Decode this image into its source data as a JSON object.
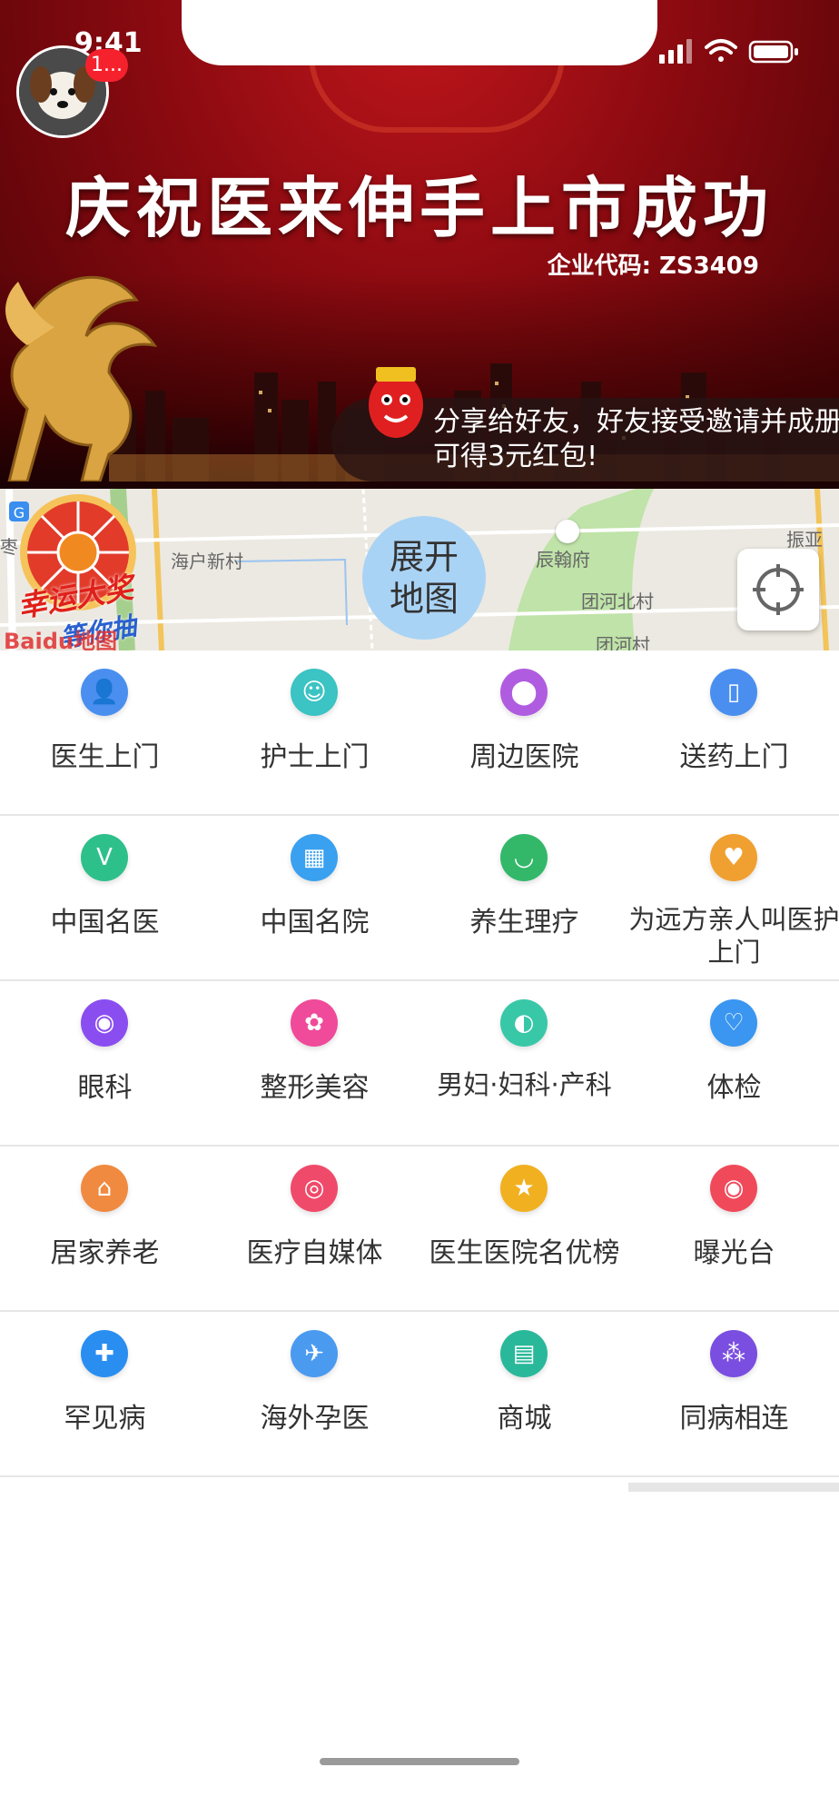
{
  "status_bar": {
    "time": "9:41"
  },
  "profile": {
    "badge": "1..."
  },
  "banner": {
    "title": "庆祝医来伸手上市成功",
    "company_code": "企业代码: ZS3409",
    "share_text": "分享给好友，好友接受邀请并成册可得3元红包!"
  },
  "map": {
    "expand_label_line1": "展开",
    "expand_label_line2": "地图",
    "labels": [
      "海户新村",
      "辰翰府",
      "团河北村",
      "团河村",
      "振亚庄",
      "枣"
    ],
    "lucky_text_1": "幸运大奖",
    "lucky_text_2": "等你抽",
    "baidu": "Baidu地图"
  },
  "grid": {
    "rows": [
      [
        {
          "label": "医生上门",
          "icon": "doctor-icon",
          "color": "#4a8ff0"
        },
        {
          "label": "护士上门",
          "icon": "nurse-icon",
          "color": "#3cc3c3"
        },
        {
          "label": "周边医院",
          "icon": "location-pin-icon",
          "color": "#b05ce0"
        },
        {
          "label": "送药上门",
          "icon": "medicine-bag-icon",
          "color": "#4a8ff0"
        }
      ],
      [
        {
          "label": "中国名医",
          "icon": "famous-doctor-icon",
          "color": "#2ec08a"
        },
        {
          "label": "中国名院",
          "icon": "hospital-building-icon",
          "color": "#3aa0f0"
        },
        {
          "label": "养生理疗",
          "icon": "mortar-bowl-icon",
          "color": "#33b86a"
        },
        {
          "label": "为远方亲人叫医护上门",
          "icon": "heart-hands-icon",
          "color": "#f0a030"
        }
      ],
      [
        {
          "label": "眼科",
          "icon": "eye-icon",
          "color": "#8a4ef0"
        },
        {
          "label": "整形美容",
          "icon": "beauty-icon",
          "color": "#f04a9a"
        },
        {
          "label": "男妇·妇科·产科",
          "icon": "pregnancy-icon",
          "color": "#38c8a8"
        },
        {
          "label": "体检",
          "icon": "stethoscope-icon",
          "color": "#3a96f0"
        }
      ],
      [
        {
          "label": "居家养老",
          "icon": "home-icon",
          "color": "#f08a40"
        },
        {
          "label": "医疗自媒体",
          "icon": "media-icon",
          "color": "#f04a6a"
        },
        {
          "label": "医生医院名优榜",
          "icon": "star-icon",
          "color": "#f0b020"
        },
        {
          "label": "曝光台",
          "icon": "exposure-icon",
          "color": "#f04a5a"
        }
      ],
      [
        {
          "label": "罕见病",
          "icon": "first-aid-icon",
          "color": "#2a8ef0"
        },
        {
          "label": "海外孕医",
          "icon": "airplane-icon",
          "color": "#4a9af0"
        },
        {
          "label": "商城",
          "icon": "shop-icon",
          "color": "#2ab89a"
        },
        {
          "label": "同病相连",
          "icon": "connect-icon",
          "color": "#7a4ee0"
        }
      ]
    ]
  }
}
